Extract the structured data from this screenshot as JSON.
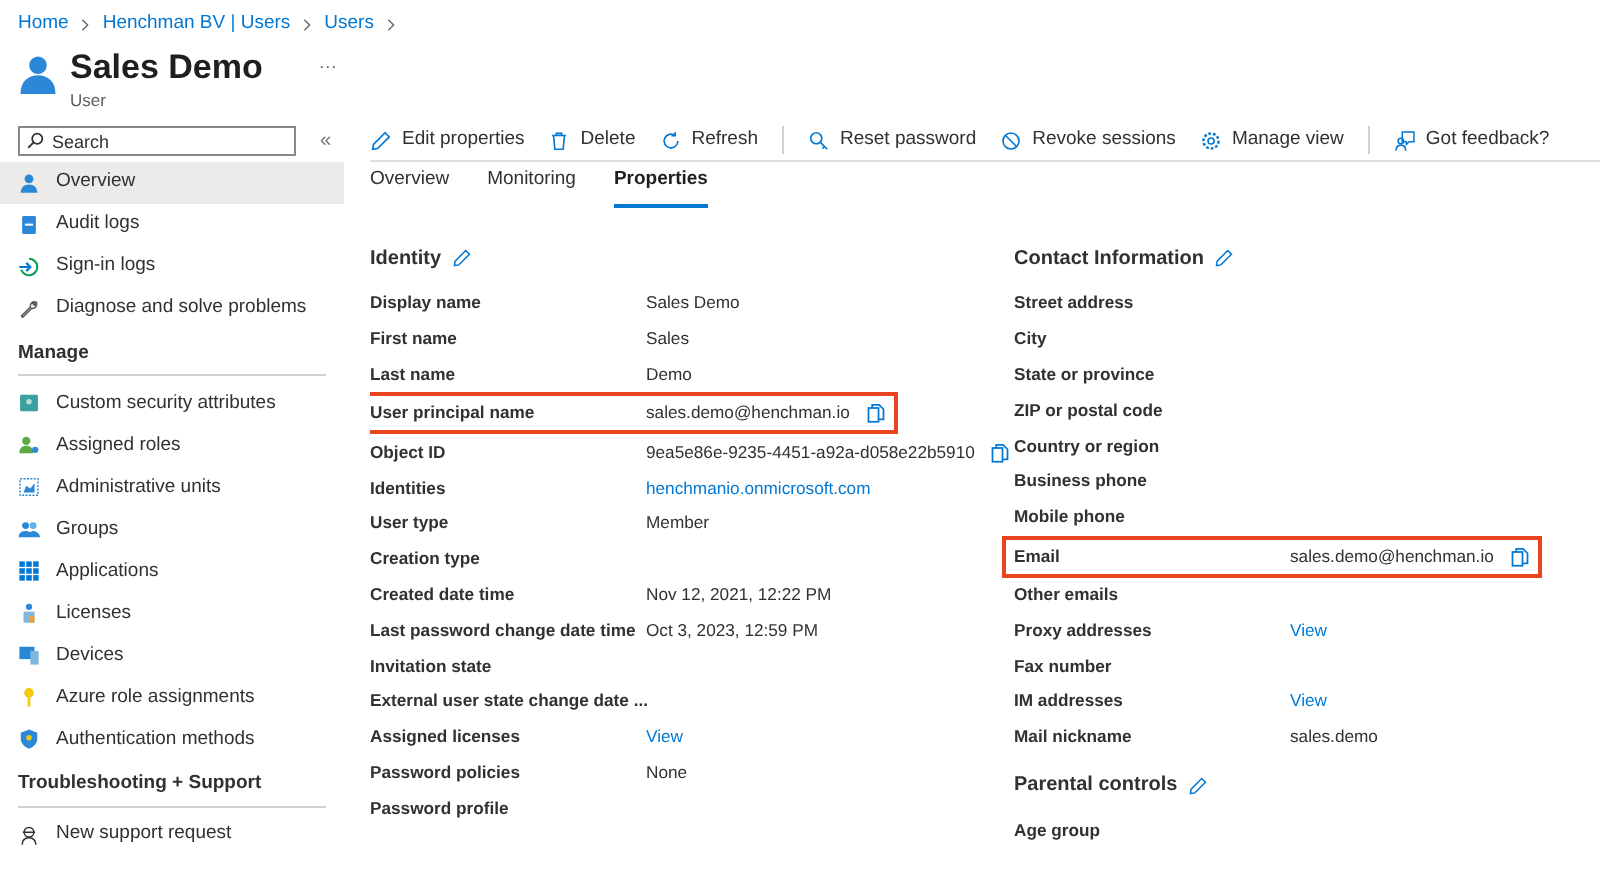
{
  "breadcrumb": [
    "Home",
    "Henchman BV | Users",
    "Users"
  ],
  "header": {
    "title": "Sales Demo",
    "subtitle": "User",
    "more": "···"
  },
  "sidebar": {
    "search": {
      "placeholder": "Search"
    },
    "collapse": "«",
    "groups": [
      {
        "items": [
          {
            "label": "Overview",
            "selected": true
          },
          {
            "label": "Audit logs",
            "selected": false
          },
          {
            "label": "Sign-in logs",
            "selected": false
          },
          {
            "label": "Diagnose and solve problems",
            "selected": false
          }
        ]
      },
      {
        "heading": "Manage",
        "items": [
          {
            "label": "Custom security attributes",
            "selected": false
          },
          {
            "label": "Assigned roles",
            "selected": false
          },
          {
            "label": "Administrative units",
            "selected": false
          },
          {
            "label": "Groups",
            "selected": false
          },
          {
            "label": "Applications",
            "selected": false
          },
          {
            "label": "Licenses",
            "selected": false
          },
          {
            "label": "Devices",
            "selected": false
          },
          {
            "label": "Azure role assignments",
            "selected": false
          },
          {
            "label": "Authentication methods",
            "selected": false
          }
        ]
      },
      {
        "heading": "Troubleshooting + Support",
        "items": [
          {
            "label": "New support request",
            "selected": false
          }
        ]
      }
    ]
  },
  "toolbar": [
    {
      "label": "Edit properties"
    },
    {
      "label": "Delete"
    },
    {
      "label": "Refresh"
    },
    {
      "label": "Reset password",
      "divider_before": true
    },
    {
      "label": "Revoke sessions"
    },
    {
      "label": "Manage view"
    },
    {
      "label": "Got feedback?",
      "divider_before": true
    }
  ],
  "tabs": [
    {
      "label": "Overview",
      "selected": false
    },
    {
      "label": "Monitoring",
      "selected": false
    },
    {
      "label": "Properties",
      "selected": true
    }
  ],
  "columns": [
    {
      "sections": [
        {
          "heading": "Identity",
          "rows": [
            {
              "label": "Display name",
              "value": "Sales Demo"
            },
            {
              "label": "First name",
              "value": "Sales"
            },
            {
              "label": "Last name",
              "value": "Demo"
            },
            {
              "label": "User principal name",
              "value": "sales.demo@henchman.io",
              "copyable": true,
              "highlighted": true
            },
            {
              "label": "Object ID",
              "value": "9ea5e86e-9235-4451-a92a-d058e22b5910",
              "copyable": true
            },
            {
              "label": "Identities",
              "value": "henchmanio.onmicrosoft.com",
              "kind": "link"
            },
            {
              "label": "User type",
              "value": "Member"
            },
            {
              "label": "Creation type"
            },
            {
              "label": "Created date time",
              "value": "Nov 12, 2021, 12:22 PM"
            },
            {
              "label": "Last password change date time",
              "value": "Oct 3, 2023, 12:59 PM"
            },
            {
              "label": "Invitation state"
            },
            {
              "label": "External user state change date ..."
            },
            {
              "label": "Assigned licenses",
              "value": "View",
              "kind": "link"
            },
            {
              "label": "Password policies",
              "value": "None"
            },
            {
              "label": "Password profile"
            }
          ]
        }
      ]
    },
    {
      "sections": [
        {
          "heading": "Contact Information",
          "rows": [
            {
              "label": "Street address"
            },
            {
              "label": "City"
            },
            {
              "label": "State or province"
            },
            {
              "label": "ZIP or postal code"
            },
            {
              "label": "Country or region"
            },
            {
              "label": "Business phone"
            },
            {
              "label": "Mobile phone"
            },
            {
              "label": "Email",
              "value": "sales.demo@henchman.io",
              "copyable": true,
              "highlighted": true
            },
            {
              "label": "Other emails"
            },
            {
              "label": "Proxy addresses",
              "value": "View",
              "kind": "link"
            },
            {
              "label": "Fax number"
            },
            {
              "label": "IM addresses",
              "value": "View",
              "kind": "link"
            },
            {
              "label": "Mail nickname",
              "value": "sales.demo"
            }
          ]
        },
        {
          "heading": "Parental controls",
          "rows": [
            {
              "label": "Age group"
            }
          ]
        }
      ]
    }
  ]
}
